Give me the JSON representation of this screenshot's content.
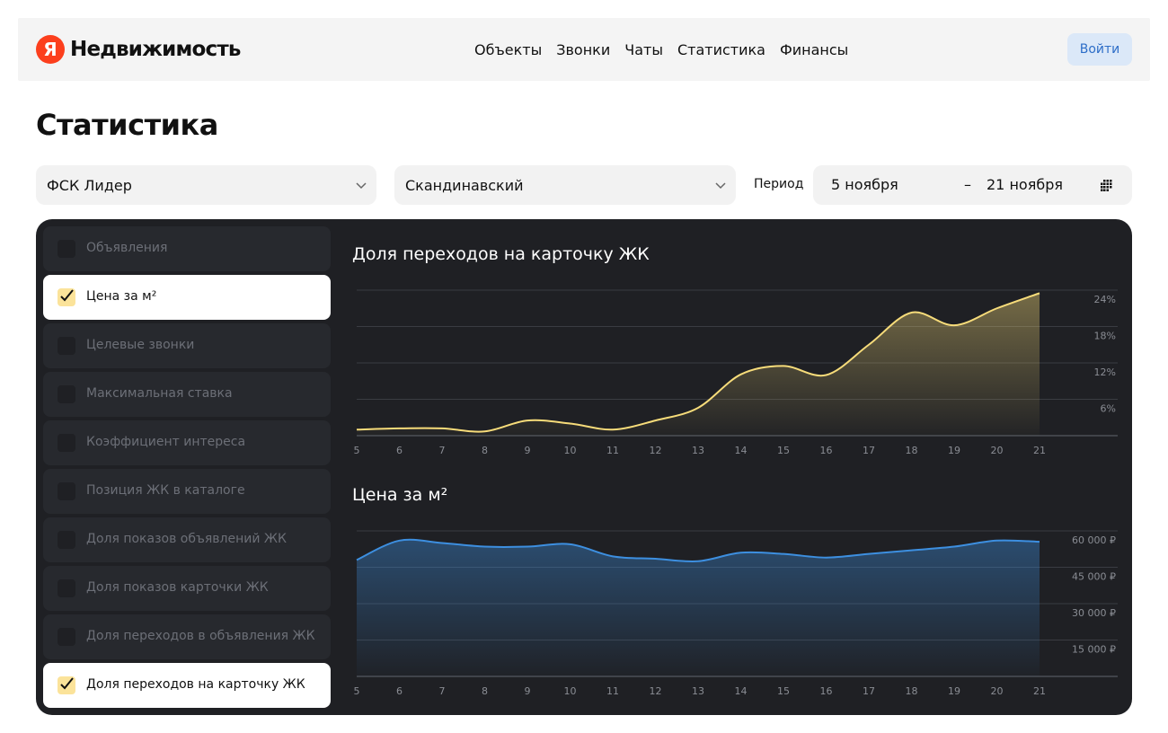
{
  "header": {
    "logo_glyph": "Я",
    "logo_text": "Недвижимость",
    "nav": [
      "Объекты",
      "Звонки",
      "Чаты",
      "Статистика",
      "Финансы"
    ],
    "login_label": "Войти"
  },
  "page_title": "Статистика",
  "filters": {
    "developer": "ФСК Лидер",
    "complex": "Скандинавский",
    "period_label": "Период",
    "period_from": "5 ноября",
    "period_dash": "–",
    "period_to": "21 ноября"
  },
  "metrics": [
    {
      "label": "Объявления",
      "checked": false
    },
    {
      "label": "Цена за м²",
      "checked": true
    },
    {
      "label": "Целевые звонки",
      "checked": false
    },
    {
      "label": "Максимальная ставка",
      "checked": false
    },
    {
      "label": "Коэффициент интереса",
      "checked": false
    },
    {
      "label": "Позиция ЖК в каталоге",
      "checked": false
    },
    {
      "label": "Доля показов объявлений ЖК",
      "checked": false
    },
    {
      "label": "Доля показов карточки ЖК",
      "checked": false
    },
    {
      "label": "Доля переходов в объявления ЖК",
      "checked": false
    },
    {
      "label": "Доля переходов на карточку ЖК",
      "checked": true
    }
  ],
  "colors": {
    "brand_red": "#fc3f1d",
    "panel_bg": "#1f2024",
    "checkbox_yellow": "#fbe39a",
    "series_yellow": "#f7dc7a",
    "series_blue": "#3d8fe0"
  },
  "chart_data": [
    {
      "type": "area",
      "title": "Доля переходов на карточку ЖК",
      "x": [
        5,
        6,
        7,
        8,
        9,
        10,
        11,
        12,
        13,
        14,
        15,
        16,
        17,
        18,
        19,
        20,
        21
      ],
      "values": [
        1.0,
        1.2,
        1.2,
        0.7,
        2.5,
        2.0,
        1.0,
        2.5,
        4.6,
        10.1,
        11.5,
        10.0,
        15.0,
        20.3,
        18.2,
        21.0,
        23.5
      ],
      "y_ticks": [
        "6%",
        "12%",
        "18%",
        "24%"
      ],
      "y_tick_values": [
        6,
        12,
        18,
        24
      ],
      "ylim": [
        0,
        24
      ],
      "grid": true
    },
    {
      "type": "area",
      "title": "Цена за м²",
      "x": [
        5,
        6,
        7,
        8,
        9,
        10,
        11,
        12,
        13,
        14,
        15,
        16,
        17,
        18,
        19,
        20,
        21
      ],
      "values": [
        48000,
        56000,
        55000,
        53500,
        53500,
        54500,
        49500,
        48500,
        47500,
        51000,
        50500,
        49000,
        50500,
        52000,
        53500,
        56000,
        55500
      ],
      "y_ticks": [
        "15 000 ₽",
        "30 000 ₽",
        "45 000 ₽",
        "60 000 ₽"
      ],
      "y_tick_values": [
        15000,
        30000,
        45000,
        60000
      ],
      "ylim": [
        0,
        60000
      ],
      "grid": true
    }
  ]
}
